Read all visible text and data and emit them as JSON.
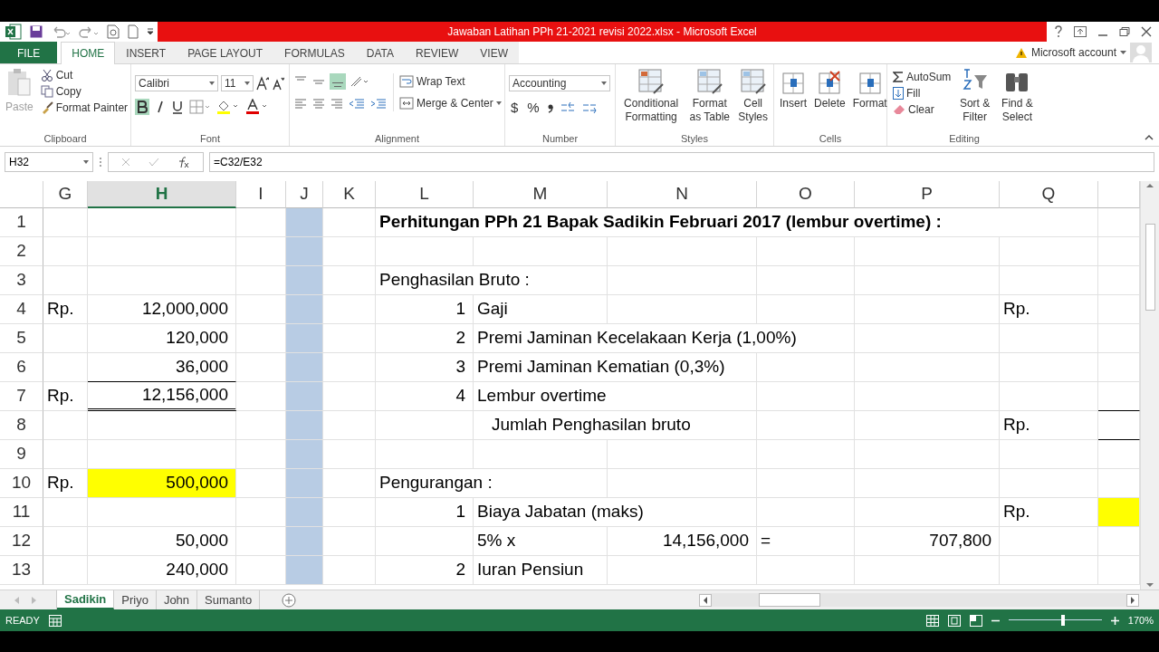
{
  "window": {
    "title": "Jawaban Latihan PPh 21-2021 revisi 2022.xlsx -  Microsoft Excel",
    "account": "Microsoft account"
  },
  "tabs": [
    {
      "label": "FILE",
      "kind": "file",
      "selected": false
    },
    {
      "label": "HOME",
      "kind": "tab",
      "selected": true
    },
    {
      "label": "INSERT",
      "kind": "tab",
      "selected": false
    },
    {
      "label": "PAGE LAYOUT",
      "kind": "tab",
      "selected": false
    },
    {
      "label": "FORMULAS",
      "kind": "tab",
      "selected": false
    },
    {
      "label": "DATA",
      "kind": "tab",
      "selected": false
    },
    {
      "label": "REVIEW",
      "kind": "tab",
      "selected": false
    },
    {
      "label": "VIEW",
      "kind": "tab",
      "selected": false
    }
  ],
  "ribbon": {
    "clipboard": {
      "label": "Clipboard",
      "paste": {
        "label": "Paste",
        "disabled": true
      },
      "cut": "Cut",
      "copy": "Copy",
      "format_painter": "Format Painter"
    },
    "font": {
      "label": "Font",
      "name": "Calibri",
      "size": "11",
      "bold": {
        "selected": true
      },
      "italic": {
        "selected": false
      },
      "underline": {
        "selected": false
      }
    },
    "alignment": {
      "label": "Alignment",
      "bottom_align": {
        "selected": true
      },
      "wrap_text": "Wrap Text",
      "merge": "Merge & Center"
    },
    "number": {
      "label": "Number",
      "format": "Accounting",
      "currency": "$",
      "percent": "%"
    },
    "styles": {
      "label": "Styles",
      "items": [
        "Conditional Formatting",
        "Format as Table",
        "Cell Styles"
      ]
    },
    "cells": {
      "label": "Cells",
      "items": [
        "Insert",
        "Delete",
        "Format"
      ]
    },
    "editing": {
      "label": "Editing",
      "autosum": "AutoSum",
      "fill": "Fill",
      "clear": "Clear",
      "sort": "Sort & Filter",
      "find": "Find & Select"
    }
  },
  "formula_bar": {
    "name_box": "H32",
    "formula": "=C32/E32"
  },
  "grid": {
    "columns": [
      {
        "label": "G",
        "selected": false,
        "highlighted": false
      },
      {
        "label": "H",
        "selected": true,
        "highlighted": false
      },
      {
        "label": "I",
        "selected": false,
        "highlighted": false
      },
      {
        "label": "J",
        "selected": false,
        "highlighted": true
      },
      {
        "label": "K",
        "selected": false,
        "highlighted": false
      },
      {
        "label": "L",
        "selected": false,
        "highlighted": false
      },
      {
        "label": "M",
        "selected": false,
        "highlighted": false
      },
      {
        "label": "N",
        "selected": false,
        "highlighted": false
      },
      {
        "label": "O",
        "selected": false,
        "highlighted": false
      },
      {
        "label": "P",
        "selected": false,
        "highlighted": false
      },
      {
        "label": "Q",
        "selected": false,
        "highlighted": false
      },
      {
        "selected": false,
        "highlighted": false
      }
    ],
    "rows": [
      {
        "number": "1",
        "cells": [
          {},
          {},
          {},
          {},
          {},
          {
            "text": "Perhitungan PPh 21 Bapak Sadikin Februari 2017 (lembur overtime) :",
            "kind": "label",
            "bold": true
          },
          {},
          {},
          {},
          {},
          {},
          {}
        ]
      },
      {
        "number": "2",
        "cells": [
          {},
          {},
          {},
          {},
          {},
          {},
          {},
          {},
          {},
          {},
          {},
          {}
        ]
      },
      {
        "number": "3",
        "cells": [
          {},
          {},
          {},
          {},
          {},
          {
            "text": "Penghasilan Bruto :",
            "kind": "label"
          },
          {},
          {},
          {},
          {},
          {},
          {}
        ]
      },
      {
        "number": "4",
        "cells": [
          {
            "text": "Rp.",
            "kind": "label"
          },
          {
            "text": "12,000,000",
            "kind": "amount"
          },
          {},
          {},
          {},
          {
            "text": "1",
            "kind": "amount"
          },
          {
            "text": "Gaji",
            "kind": "label"
          },
          {},
          {},
          {},
          {
            "text": "Rp.",
            "kind": "label"
          },
          {}
        ]
      },
      {
        "number": "5",
        "cells": [
          {},
          {
            "text": "120,000",
            "kind": "amount"
          },
          {},
          {},
          {},
          {
            "text": "2",
            "kind": "amount"
          },
          {
            "text": "Premi Jaminan Kecelakaan Kerja (1,00%)",
            "kind": "label"
          },
          {},
          {},
          {},
          {},
          {}
        ]
      },
      {
        "number": "6",
        "cells": [
          {},
          {
            "text": "36,000",
            "kind": "amount_underlined"
          },
          {},
          {},
          {},
          {
            "text": "3",
            "kind": "amount"
          },
          {
            "text": "Premi Jaminan Kematian (0,3%)",
            "kind": "label"
          },
          {},
          {},
          {},
          {},
          {}
        ]
      },
      {
        "number": "7",
        "cells": [
          {
            "text": "Rp.",
            "kind": "label"
          },
          {
            "text": "12,156,000",
            "kind": "amount_double_underlined"
          },
          {},
          {},
          {},
          {
            "text": "4",
            "kind": "amount"
          },
          {
            "text": "Lembur overtime",
            "kind": "label"
          },
          {},
          {},
          {},
          {},
          {
            "kind": "underlined"
          }
        ]
      },
      {
        "number": "8",
        "cells": [
          {},
          {},
          {},
          {},
          {},
          {},
          {
            "text": "Jumlah Penghasilan bruto",
            "kind": "indented"
          },
          {},
          {},
          {},
          {
            "text": "Rp.",
            "kind": "label"
          },
          {
            "kind": "underlined"
          }
        ]
      },
      {
        "number": "9",
        "cells": [
          {},
          {},
          {},
          {},
          {},
          {},
          {},
          {},
          {},
          {},
          {},
          {}
        ]
      },
      {
        "number": "10",
        "cells": [
          {
            "text": "Rp.",
            "kind": "label"
          },
          {
            "text": "500,000",
            "kind": "amount",
            "highlighted": true
          },
          {},
          {},
          {},
          {
            "text": "Pengurangan :",
            "kind": "label"
          },
          {},
          {},
          {},
          {},
          {},
          {}
        ]
      },
      {
        "number": "11",
        "cells": [
          {},
          {},
          {},
          {},
          {},
          {
            "text": "1",
            "kind": "amount"
          },
          {
            "text": "Biaya Jabatan (maks)",
            "kind": "label"
          },
          {},
          {},
          {},
          {
            "text": "Rp.",
            "kind": "label"
          },
          {
            "highlighted": true
          }
        ]
      },
      {
        "number": "12",
        "cells": [
          {},
          {
            "text": "50,000",
            "kind": "amount"
          },
          {},
          {},
          {},
          {},
          {
            "text": "5% x",
            "kind": "label"
          },
          {
            "text": "14,156,000",
            "kind": "amount"
          },
          {
            "text": "=",
            "kind": "label"
          },
          {
            "text": "707,800",
            "kind": "amount"
          },
          {},
          {}
        ]
      },
      {
        "number": "13",
        "cells": [
          {},
          {
            "text": "240,000",
            "kind": "amount"
          },
          {},
          {},
          {},
          {
            "text": "2",
            "kind": "amount"
          },
          {
            "text": "Iuran Pensiun",
            "kind": "label"
          },
          {},
          {},
          {},
          {},
          {}
        ]
      }
    ]
  },
  "sheets": [
    {
      "label": "Sadikin",
      "selected": true
    },
    {
      "label": "Priyo",
      "selected": false
    },
    {
      "label": "John",
      "selected": false
    },
    {
      "label": "Sumanto",
      "selected": false
    }
  ],
  "status_bar": {
    "mode": "READY",
    "zoom": {
      "level": 0.58
    },
    "zoom_text": "170%"
  }
}
